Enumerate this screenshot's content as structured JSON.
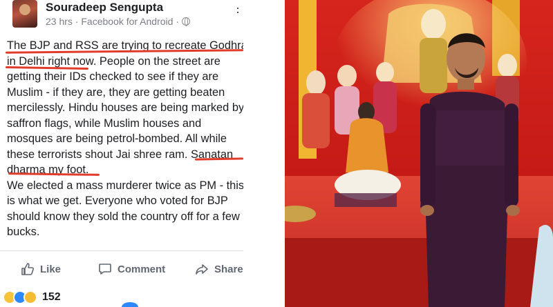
{
  "post": {
    "author": "Souradeep Sengupta",
    "meta": "23 hrs · Facebook for Android ·",
    "lines": [
      "The BJP and RSS are trying to recreate Godhra",
      "in Delhi right now. People on the street are",
      "getting their IDs checked to see if they are",
      "Muslim - if they are, they are getting beaten",
      "mercilessly. Hindu houses are being marked by",
      "saffron flags, while Muslim houses and",
      "mosques are being petrol-bombed. All while",
      "these terrorists shout Jai shree ram. Sanatan",
      "dharma my foot.",
      "We elected a mass murderer twice as PM - this",
      "is what we get. Everyone who voted for BJP",
      "should know they sold the country off for a few",
      "bucks."
    ],
    "actions": {
      "like": "Like",
      "comment": "Comment",
      "share": "Share"
    },
    "reaction_count": "152",
    "highlight_color": "#e23b2a"
  }
}
